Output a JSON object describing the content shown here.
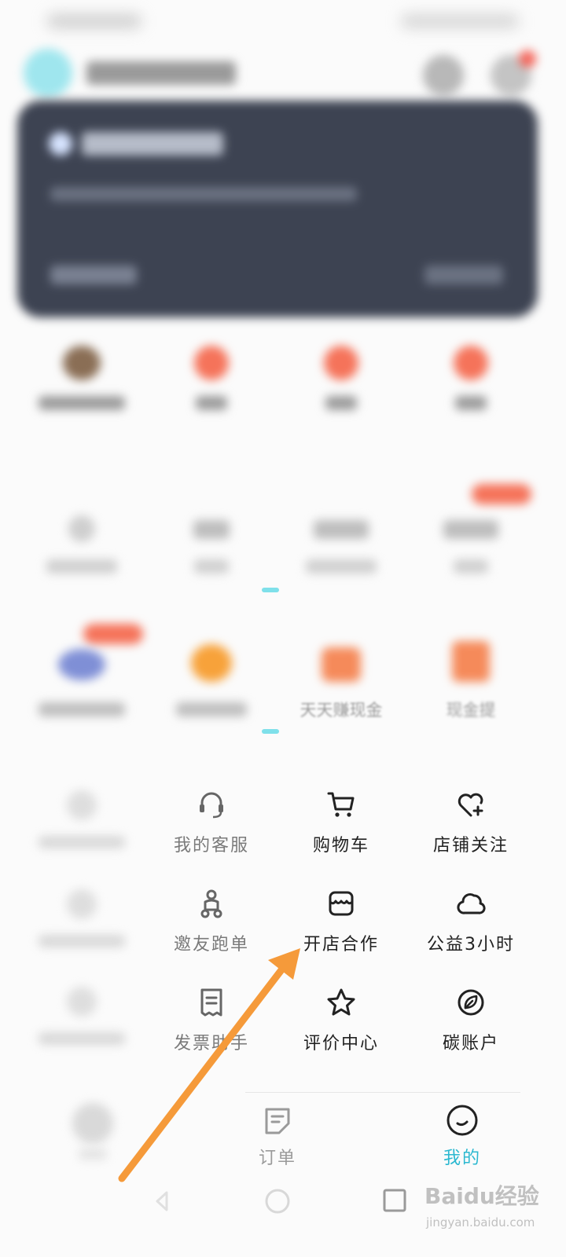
{
  "colors": {
    "accent": "#2bb8d0",
    "tab_inactive": "#9a9a9a",
    "arrow": "#f59a3a",
    "card_bg": "#3d4352"
  },
  "top_promo_row": [
    {
      "blob_color": "#8a6e55"
    },
    {
      "blob_color": "#f5735a"
    },
    {
      "blob_color": "#f5735a"
    },
    {
      "blob_color": "#f5735a"
    }
  ],
  "promo_row_2": {
    "visible_label": "天天赚现金",
    "visible_label_2": "现金提"
  },
  "menu": [
    {
      "label": "我的客服",
      "icon": "headset-icon",
      "faded": true
    },
    {
      "label": "购物车",
      "icon": "shopping-cart-icon"
    },
    {
      "label": "店铺关注",
      "icon": "heart-plus-icon"
    },
    {
      "label": "邀友跑单",
      "icon": "scooter-rider-icon",
      "faded": true
    },
    {
      "label": "开店合作",
      "icon": "storefront-icon"
    },
    {
      "label": "公益3小时",
      "icon": "cloud-icon"
    },
    {
      "label": "发票助手",
      "icon": "receipt-icon",
      "faded": true
    },
    {
      "label": "评价中心",
      "icon": "star-icon"
    },
    {
      "label": "碳账户",
      "icon": "leaf-icon"
    }
  ],
  "tabs": [
    {
      "label": "订单",
      "icon": "order-note-icon",
      "active": false
    },
    {
      "label": "我的",
      "icon": "smile-face-icon",
      "active": true
    }
  ],
  "watermark": {
    "brand": "Baidu经验",
    "url": "jingyan.baidu.com"
  }
}
